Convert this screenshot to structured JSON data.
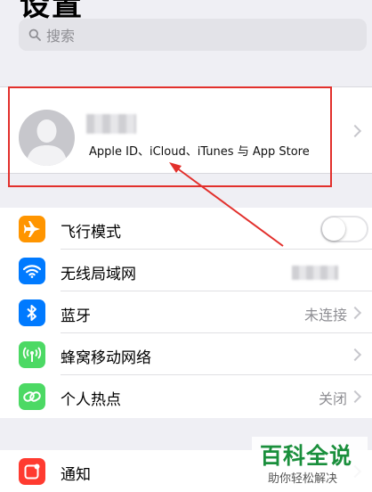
{
  "header": {
    "title": "设置"
  },
  "search": {
    "placeholder": "搜索",
    "icon": "search-icon"
  },
  "profile": {
    "subtitle": "Apple ID、iCloud、iTunes 与 App Store",
    "icon": "person-silhouette-icon"
  },
  "settings": [
    {
      "label": "飞行模式",
      "icon": "airplane-icon",
      "color": "#ff9500",
      "control": "toggle",
      "on": false
    },
    {
      "label": "无线局域网",
      "icon": "wifi-icon",
      "color": "#007aff",
      "control": "blurred-value"
    },
    {
      "label": "蓝牙",
      "icon": "bluetooth-icon",
      "color": "#007aff",
      "value": "未连接"
    },
    {
      "label": "蜂窝移动网络",
      "icon": "cellular-antenna-icon",
      "color": "#4cd964"
    },
    {
      "label": "个人热点",
      "icon": "hotspot-link-icon",
      "color": "#4cd964",
      "value": "关闭"
    }
  ],
  "notifications": {
    "label": "通知",
    "icon": "notification-icon",
    "color": "#ff3b30"
  },
  "watermark": {
    "title": "百科全说",
    "subtitle": "助你轻松解决"
  },
  "annotation": {
    "box_color": "#e2302c"
  }
}
